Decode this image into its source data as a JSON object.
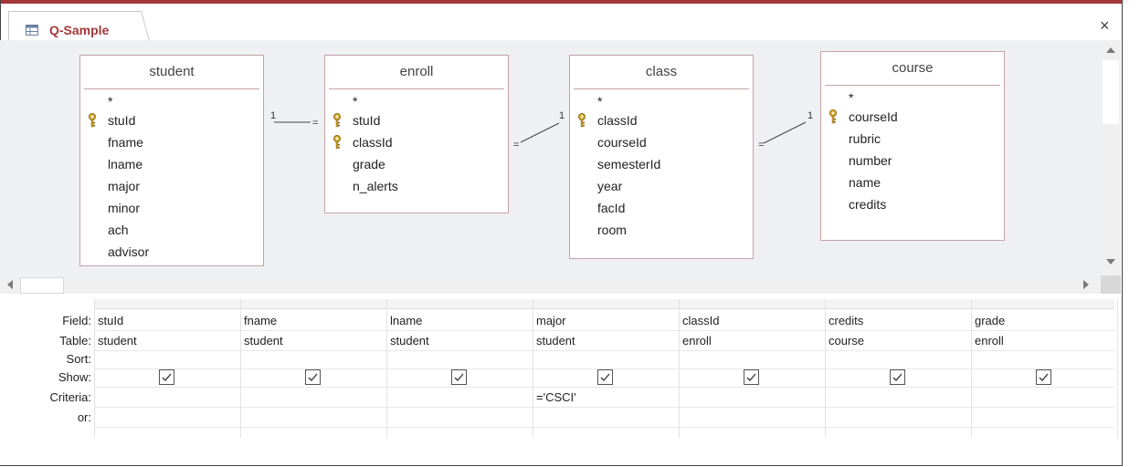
{
  "window": {
    "tab_title": "Q-Sample",
    "close_label": "×"
  },
  "tables": [
    {
      "name": "student",
      "fields": [
        {
          "label": "*",
          "key": false
        },
        {
          "label": "stuId",
          "key": true
        },
        {
          "label": "fname",
          "key": false
        },
        {
          "label": "lname",
          "key": false
        },
        {
          "label": "major",
          "key": false
        },
        {
          "label": "minor",
          "key": false
        },
        {
          "label": "ach",
          "key": false
        },
        {
          "label": "advisor",
          "key": false
        }
      ]
    },
    {
      "name": "enroll",
      "fields": [
        {
          "label": "*",
          "key": false
        },
        {
          "label": "stuId",
          "key": true
        },
        {
          "label": "classId",
          "key": true
        },
        {
          "label": "grade",
          "key": false
        },
        {
          "label": "n_alerts",
          "key": false
        }
      ]
    },
    {
      "name": "class",
      "fields": [
        {
          "label": "*",
          "key": false
        },
        {
          "label": "classId",
          "key": true
        },
        {
          "label": "courseId",
          "key": false
        },
        {
          "label": "semesterId",
          "key": false
        },
        {
          "label": "year",
          "key": false
        },
        {
          "label": "facId",
          "key": false
        },
        {
          "label": "room",
          "key": false
        }
      ]
    },
    {
      "name": "course",
      "fields": [
        {
          "label": "*",
          "key": false
        },
        {
          "label": "courseId",
          "key": true
        },
        {
          "label": "rubric",
          "key": false
        },
        {
          "label": "number",
          "key": false
        },
        {
          "label": "name",
          "key": false
        },
        {
          "label": "credits",
          "key": false
        }
      ]
    }
  ],
  "join_marks": {
    "one": "1",
    "many": "="
  },
  "grid": {
    "row_labels": [
      "Field:",
      "Table:",
      "Sort:",
      "Show:",
      "Criteria:",
      "or:"
    ],
    "columns": [
      {
        "field": "stuId",
        "table": "student",
        "sort": "",
        "show": true,
        "criteria": "",
        "or": ""
      },
      {
        "field": "fname",
        "table": "student",
        "sort": "",
        "show": true,
        "criteria": "",
        "or": ""
      },
      {
        "field": "lname",
        "table": "student",
        "sort": "",
        "show": true,
        "criteria": "",
        "or": ""
      },
      {
        "field": "major",
        "table": "student",
        "sort": "",
        "show": true,
        "criteria": "='CSCI'",
        "or": ""
      },
      {
        "field": "classId",
        "table": "enroll",
        "sort": "",
        "show": true,
        "criteria": "",
        "or": ""
      },
      {
        "field": "credits",
        "table": "course",
        "sort": "",
        "show": true,
        "criteria": "",
        "or": ""
      },
      {
        "field": "grade",
        "table": "enroll",
        "sort": "",
        "show": true,
        "criteria": "",
        "or": ""
      }
    ]
  },
  "colors": {
    "accent": "#a4373a",
    "canvas": "#eef0f4",
    "table_border": "#c5a3a3"
  }
}
